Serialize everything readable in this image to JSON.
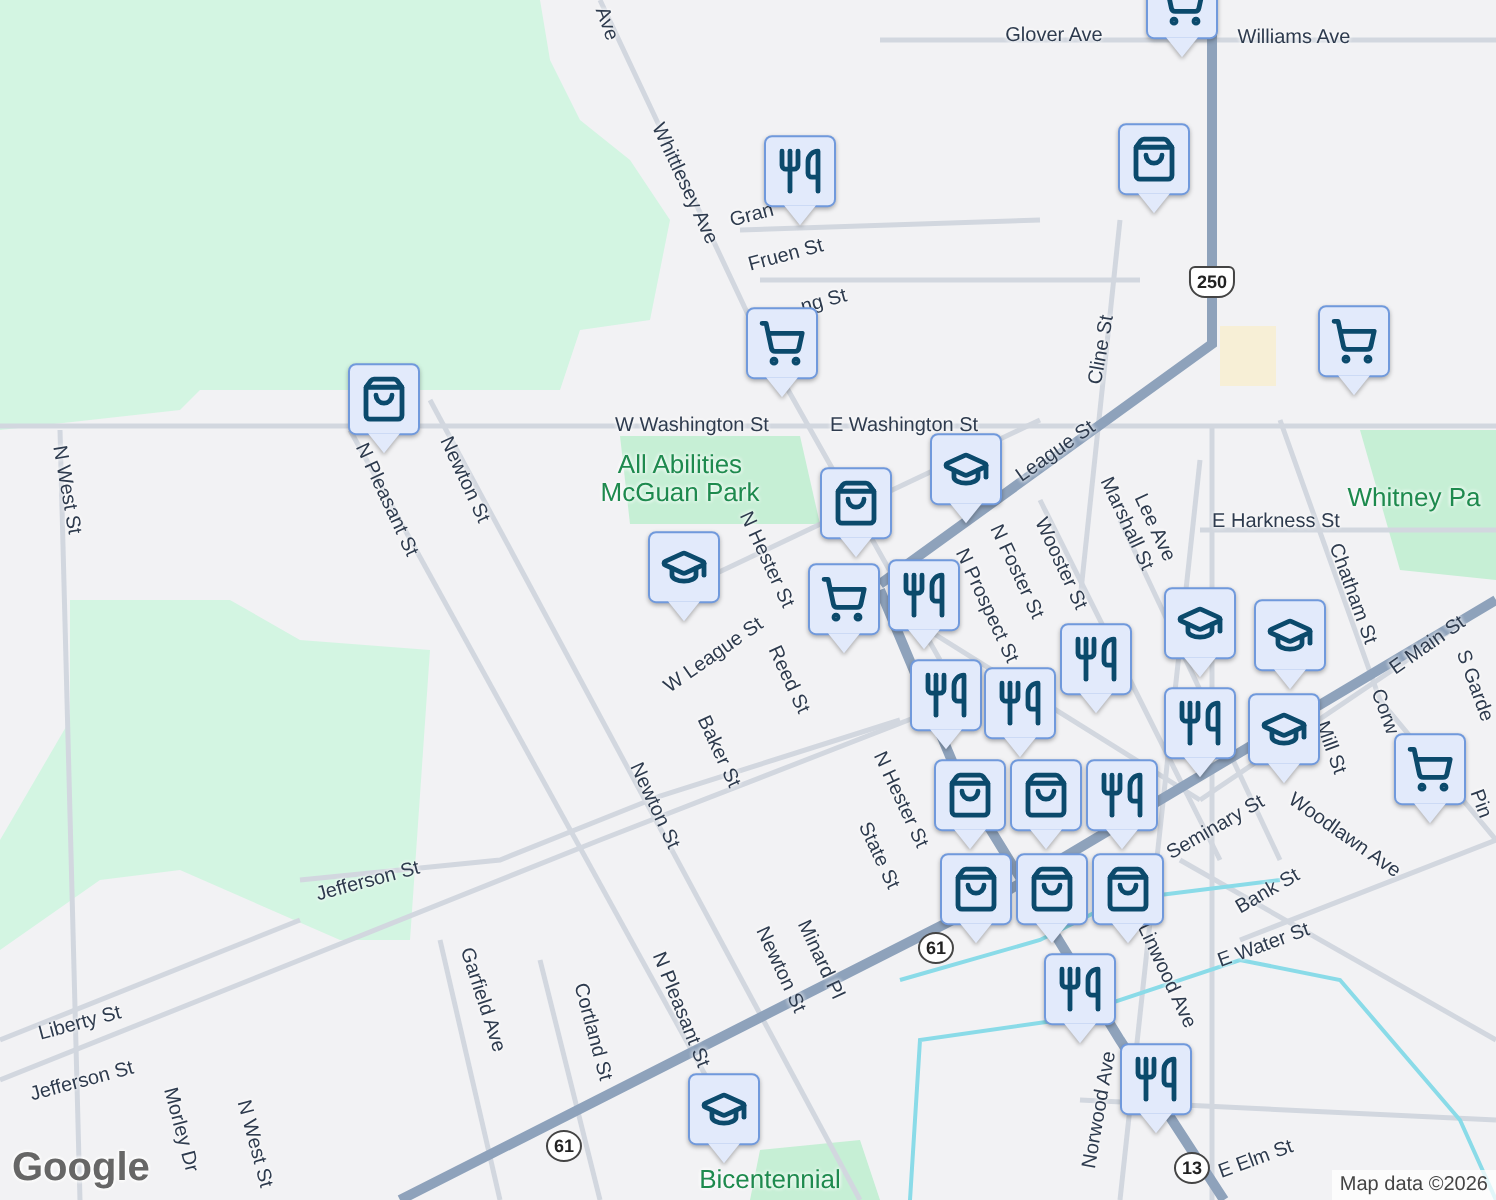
{
  "map": {
    "labels": [
      {
        "text": "Ave",
        "kind": "street"
      },
      {
        "text": "Glover Ave",
        "kind": "street"
      },
      {
        "text": "Williams Ave",
        "kind": "street"
      },
      {
        "text": "Whittlesey Ave",
        "kind": "street"
      },
      {
        "text": "Gran",
        "kind": "street"
      },
      {
        "text": "Fruen St",
        "kind": "street"
      },
      {
        "text": "ng St",
        "kind": "street"
      },
      {
        "text": "W Washington St",
        "kind": "street"
      },
      {
        "text": "E Washington St",
        "kind": "street"
      },
      {
        "text": "League St",
        "kind": "street"
      },
      {
        "text": "Cline St",
        "kind": "street"
      },
      {
        "text": "Marshall St",
        "kind": "street"
      },
      {
        "text": "Lee Ave",
        "kind": "street"
      },
      {
        "text": "Wooster St",
        "kind": "street"
      },
      {
        "text": "N Foster St",
        "kind": "street"
      },
      {
        "text": "N Prospect St",
        "kind": "street"
      },
      {
        "text": "E Harkness St",
        "kind": "street"
      },
      {
        "text": "Whitney Pa",
        "kind": "park"
      },
      {
        "text": "All Abilities McGuan Park",
        "kind": "park"
      },
      {
        "text": "N Hester St",
        "kind": "street"
      },
      {
        "text": "W League St",
        "kind": "street"
      },
      {
        "text": "Reed St",
        "kind": "street"
      },
      {
        "text": "Baker St",
        "kind": "street"
      },
      {
        "text": "Newton St",
        "kind": "street"
      },
      {
        "text": "N Pleasant St",
        "kind": "street"
      },
      {
        "text": "N West St",
        "kind": "street"
      },
      {
        "text": "Newton St",
        "kind": "street"
      },
      {
        "text": "Jefferson St",
        "kind": "street"
      },
      {
        "text": "Liberty St",
        "kind": "street"
      },
      {
        "text": "Jefferson St",
        "kind": "street"
      },
      {
        "text": "Garfield Ave",
        "kind": "street"
      },
      {
        "text": "Cortland St",
        "kind": "street"
      },
      {
        "text": "N Pleasant St",
        "kind": "street"
      },
      {
        "text": "Morley Dr",
        "kind": "street"
      },
      {
        "text": "N West St",
        "kind": "street"
      },
      {
        "text": "Newton St",
        "kind": "street"
      },
      {
        "text": "Minard Pl",
        "kind": "street"
      },
      {
        "text": "State St",
        "kind": "street"
      },
      {
        "text": "N Hester St",
        "kind": "street"
      },
      {
        "text": "E Main St",
        "kind": "street"
      },
      {
        "text": "S Garde",
        "kind": "street"
      },
      {
        "text": "Chatham St",
        "kind": "street"
      },
      {
        "text": "Corw",
        "kind": "street"
      },
      {
        "text": "Mill St",
        "kind": "street"
      },
      {
        "text": "Woodlawn Ave",
        "kind": "street"
      },
      {
        "text": "Seminary St",
        "kind": "street"
      },
      {
        "text": "Bank St",
        "kind": "street"
      },
      {
        "text": "E Water St",
        "kind": "street"
      },
      {
        "text": "Linwood Ave",
        "kind": "street"
      },
      {
        "text": "Norwood Ave",
        "kind": "street"
      },
      {
        "text": "E Elm St",
        "kind": "street"
      },
      {
        "text": "Pin",
        "kind": "street"
      },
      {
        "text": "Bicentennial",
        "kind": "park"
      }
    ],
    "shields": [
      {
        "text": "250",
        "kind": "us"
      },
      {
        "text": "61",
        "kind": "state"
      },
      {
        "text": "61",
        "kind": "state"
      },
      {
        "text": "13",
        "kind": "state"
      }
    ],
    "markers": [
      {
        "kind": "grocery"
      },
      {
        "kind": "food"
      },
      {
        "kind": "shopping"
      },
      {
        "kind": "grocery"
      },
      {
        "kind": "grocery"
      },
      {
        "kind": "shopping"
      },
      {
        "kind": "school"
      },
      {
        "kind": "school"
      },
      {
        "kind": "shopping"
      },
      {
        "kind": "grocery"
      },
      {
        "kind": "food"
      },
      {
        "kind": "school"
      },
      {
        "kind": "food"
      },
      {
        "kind": "school"
      },
      {
        "kind": "food"
      },
      {
        "kind": "food"
      },
      {
        "kind": "food"
      },
      {
        "kind": "shopping"
      },
      {
        "kind": "shopping"
      },
      {
        "kind": "school"
      },
      {
        "kind": "grocery"
      },
      {
        "kind": "food"
      },
      {
        "kind": "shopping"
      },
      {
        "kind": "shopping"
      },
      {
        "kind": "shopping"
      },
      {
        "kind": "food"
      },
      {
        "kind": "food"
      },
      {
        "kind": "school"
      }
    ]
  },
  "logo": "Google",
  "attribution": "Map data ©2026"
}
